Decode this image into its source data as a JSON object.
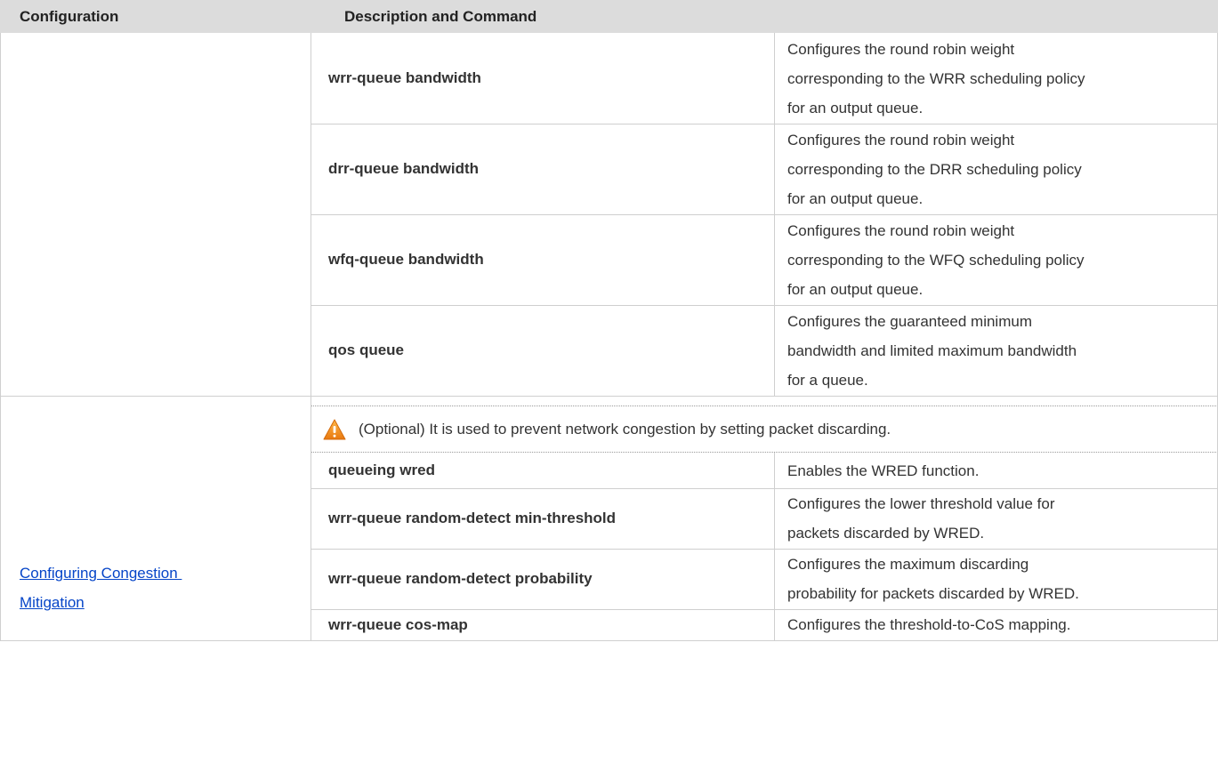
{
  "header": {
    "configuration": "Configuration",
    "description": "Description and Command"
  },
  "group1_rows": [
    {
      "command": "wrr-queue bandwidth",
      "lines": [
        "Configures the round robin weight",
        "corresponding to the WRR scheduling policy",
        "for an output queue."
      ]
    },
    {
      "command": "drr-queue bandwidth",
      "lines": [
        "Configures the round robin weight",
        "corresponding to the DRR scheduling policy",
        "for an output queue."
      ]
    },
    {
      "command": "wfq-queue bandwidth",
      "lines": [
        "Configures the round robin weight",
        "corresponding to the WFQ scheduling policy",
        "for an output queue."
      ]
    },
    {
      "command": "qos queue",
      "lines": [
        "Configures the guaranteed minimum",
        "bandwidth and limited maximum bandwidth",
        "for a queue."
      ]
    }
  ],
  "group2": {
    "link_line1": "Configuring Congestion ",
    "link_line2": "Mitigation",
    "note_icon": "warning-icon",
    "note_text": "(Optional) It is used to prevent network congestion by setting packet discarding.",
    "rows": [
      {
        "command": "queueing wred",
        "lines": [
          "Enables the WRED function."
        ]
      },
      {
        "command": "wrr-queue random-detect min-threshold",
        "lines": [
          "Configures the lower threshold value for",
          "packets discarded by WRED."
        ]
      },
      {
        "command": "wrr-queue random-detect probability",
        "lines": [
          "Configures the maximum discarding",
          "probability for packets discarded by WRED."
        ]
      },
      {
        "command": "wrr-queue cos-map",
        "lines": [
          "Configures the threshold-to-CoS mapping."
        ]
      }
    ]
  },
  "colors": {
    "header_bg": "#dcdcdc",
    "link": "#0645c8",
    "warning": "#f39a1e"
  }
}
